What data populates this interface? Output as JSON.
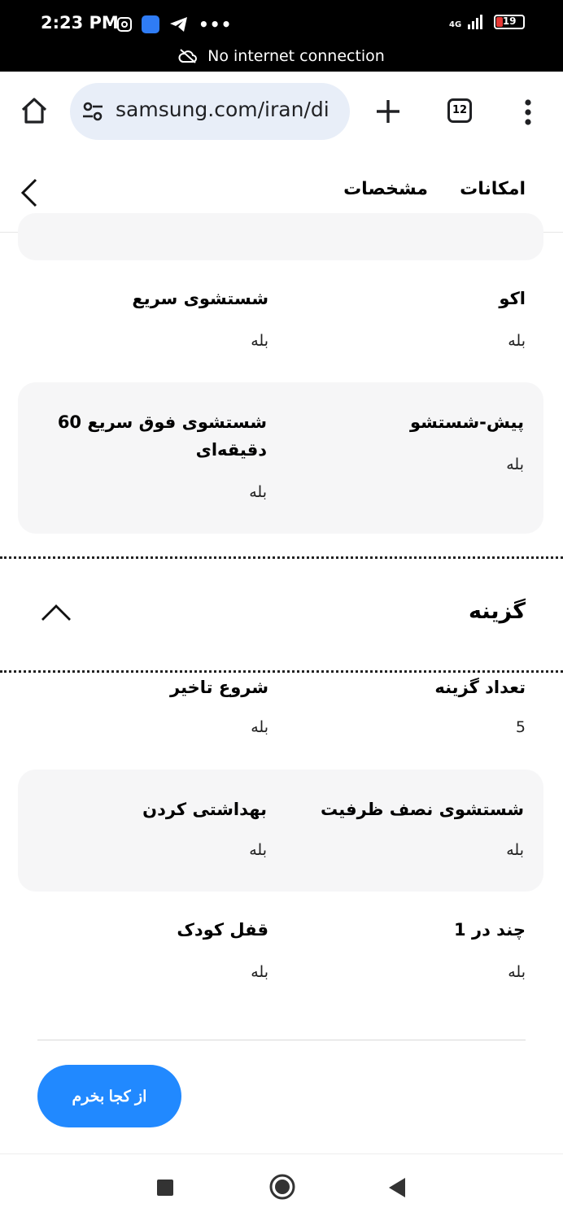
{
  "status_bar": {
    "time": "2:23 PM",
    "network_label": "4G",
    "battery": "19",
    "no_internet": "No internet connection",
    "icons": [
      "instagram-icon",
      "app-icon",
      "telegram-icon",
      "more-notifications-icon",
      "signal-icon",
      "battery-icon",
      "cloud-off-icon"
    ]
  },
  "browser": {
    "url": "samsung.com/iran/di",
    "tab_count": "12"
  },
  "tabs": [
    {
      "label": "امکانات"
    },
    {
      "label": "مشخصات"
    }
  ],
  "specs_top": [
    {
      "title": "اکو",
      "value": "بله"
    },
    {
      "title": "شستشوی سریع",
      "value": "بله"
    }
  ],
  "specs_card1": [
    {
      "title": "پیش-شستشو",
      "value": "بله"
    },
    {
      "title": "شستشوی فوق سریع 60 دقیقه‌ای",
      "value": "بله"
    }
  ],
  "section": {
    "title": "گزینه"
  },
  "options_row1": [
    {
      "title": "تعداد گزینه",
      "value": "5"
    },
    {
      "title": "شروع تاخیر",
      "value": "بله"
    }
  ],
  "options_card2": [
    {
      "title": "شستشوی نصف ظرفیت",
      "value": "بله"
    },
    {
      "title": "بهداشتی کردن",
      "value": "بله"
    }
  ],
  "options_row3": [
    {
      "title": "چند در 1",
      "value": "بله"
    },
    {
      "title": "قفل کودک",
      "value": "بله"
    }
  ],
  "buy_button": {
    "label": "از کجا بخرم"
  },
  "colors": {
    "accent": "#2189ff",
    "card_bg": "#f6f6f7",
    "status_bg": "#000000"
  }
}
